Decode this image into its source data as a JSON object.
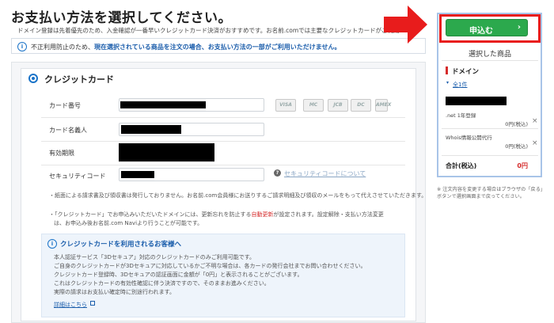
{
  "header": {
    "title": "お支払い方法を選択してください。",
    "intro": "ドメイン登録は先着優先のため、入金確認が一番早いクレジットカード決済がおすすめです。お名前.comでは主要なクレジットカードがご利用"
  },
  "notice": {
    "prefix": "不正利用防止のため、",
    "highlight": "現在選択されている商品を注文の場合、お支払い方法の一部がご利用いただけません。"
  },
  "payment": {
    "title": "クレジットカード",
    "card_number_label": "カード番号",
    "card_holder_label": "カード名義人",
    "expiry_label": "有効期限",
    "security_code_label": "セキュリティコード",
    "security_help_link": "セキュリティコードについて",
    "brands": [
      "VISA",
      "MC",
      "JCB",
      "DC",
      "AMEX"
    ],
    "notes": [
      "・紙面による請求書及び領収書は発行しておりません。お名前.com会員様にお送りするご請求明細及び領収のメールをもって代えさせていただきます。",
      "・「クレジットカード」でお申込みいただいたドメインには、更新忘れを防止する",
      "自動更新",
      "が設定されます。設定解除・支払い方法変更",
      "は、お申込み後お名前.com Naviより行うことが可能です。"
    ]
  },
  "info": {
    "title": "クレジットカードを利用されるお客様へ",
    "lines": [
      "本人認証サービス「3Dセキュア」対応のクレジットカードのみご利用可能です。",
      "ご自身のクレジットカードが3Dセキュアに対応しているかご不明な場合は、各カードの発行会社までお問い合わせください。",
      "クレジットカード登録時、3Dセキュアの認証画面に金額が「0円」と表示されることがございます。",
      "これはクレジットカードの有効性確認に伴う決済ですので、そのままお進みください。",
      "実際の請求はお支払い確定時に別途行われます。"
    ],
    "detail_link": "詳細はこちら"
  },
  "sidebar": {
    "apply_label": "申込む",
    "chevron": "›",
    "selected_title": "選択した商品",
    "category": "ドメイン",
    "count_link": "全1件",
    "items": [
      {
        "name": ".net 1年登録",
        "price": "0円(税込)"
      },
      {
        "name": "Whois情報公開代行",
        "price": "0円(税込)"
      }
    ],
    "total_label": "合計(税込)",
    "total_value": "0円",
    "note": "※ 注文内容を変更する場合はブラウザの「戻る」ボタンで選択画面まで戻ってください。"
  },
  "colors": {
    "accent_green": "#2ca94d",
    "highlight_red": "#e81c1c",
    "link_blue": "#1a5dab",
    "price_red": "#d52b2b"
  }
}
